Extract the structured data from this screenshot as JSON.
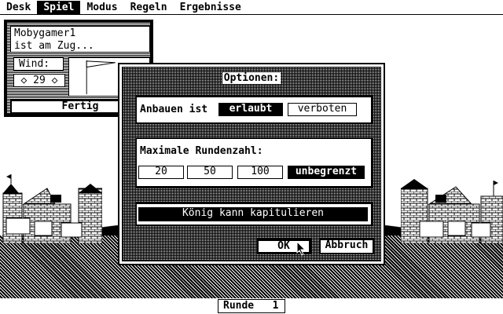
{
  "menu": {
    "items": [
      {
        "label": "Desk"
      },
      {
        "label": "Spiel"
      },
      {
        "label": "Modus"
      },
      {
        "label": "Regeln"
      },
      {
        "label": "Ergebnisse"
      }
    ],
    "active": "Spiel"
  },
  "info_panel": {
    "message_line1": "Mobygamer1",
    "message_line2": "ist am Zug...",
    "wind_label": "Wind:",
    "wind_value": "◇ 29 ◇",
    "done_button": "Fertig"
  },
  "dialog": {
    "title": "Optionen:",
    "building": {
      "label": "Anbauen ist",
      "options": [
        "erlaubt",
        "verboten"
      ],
      "selected": "erlaubt"
    },
    "rounds": {
      "label": "Maximale Rundenzahl:",
      "options": [
        "20",
        "50",
        "100",
        "unbegrenzt"
      ],
      "selected": "unbegrenzt"
    },
    "king_option": "König kann kapitulieren",
    "ok_button": "OK",
    "cancel_button": "Abbruch"
  },
  "status": {
    "round_label": "Runde",
    "round_value": "1"
  }
}
